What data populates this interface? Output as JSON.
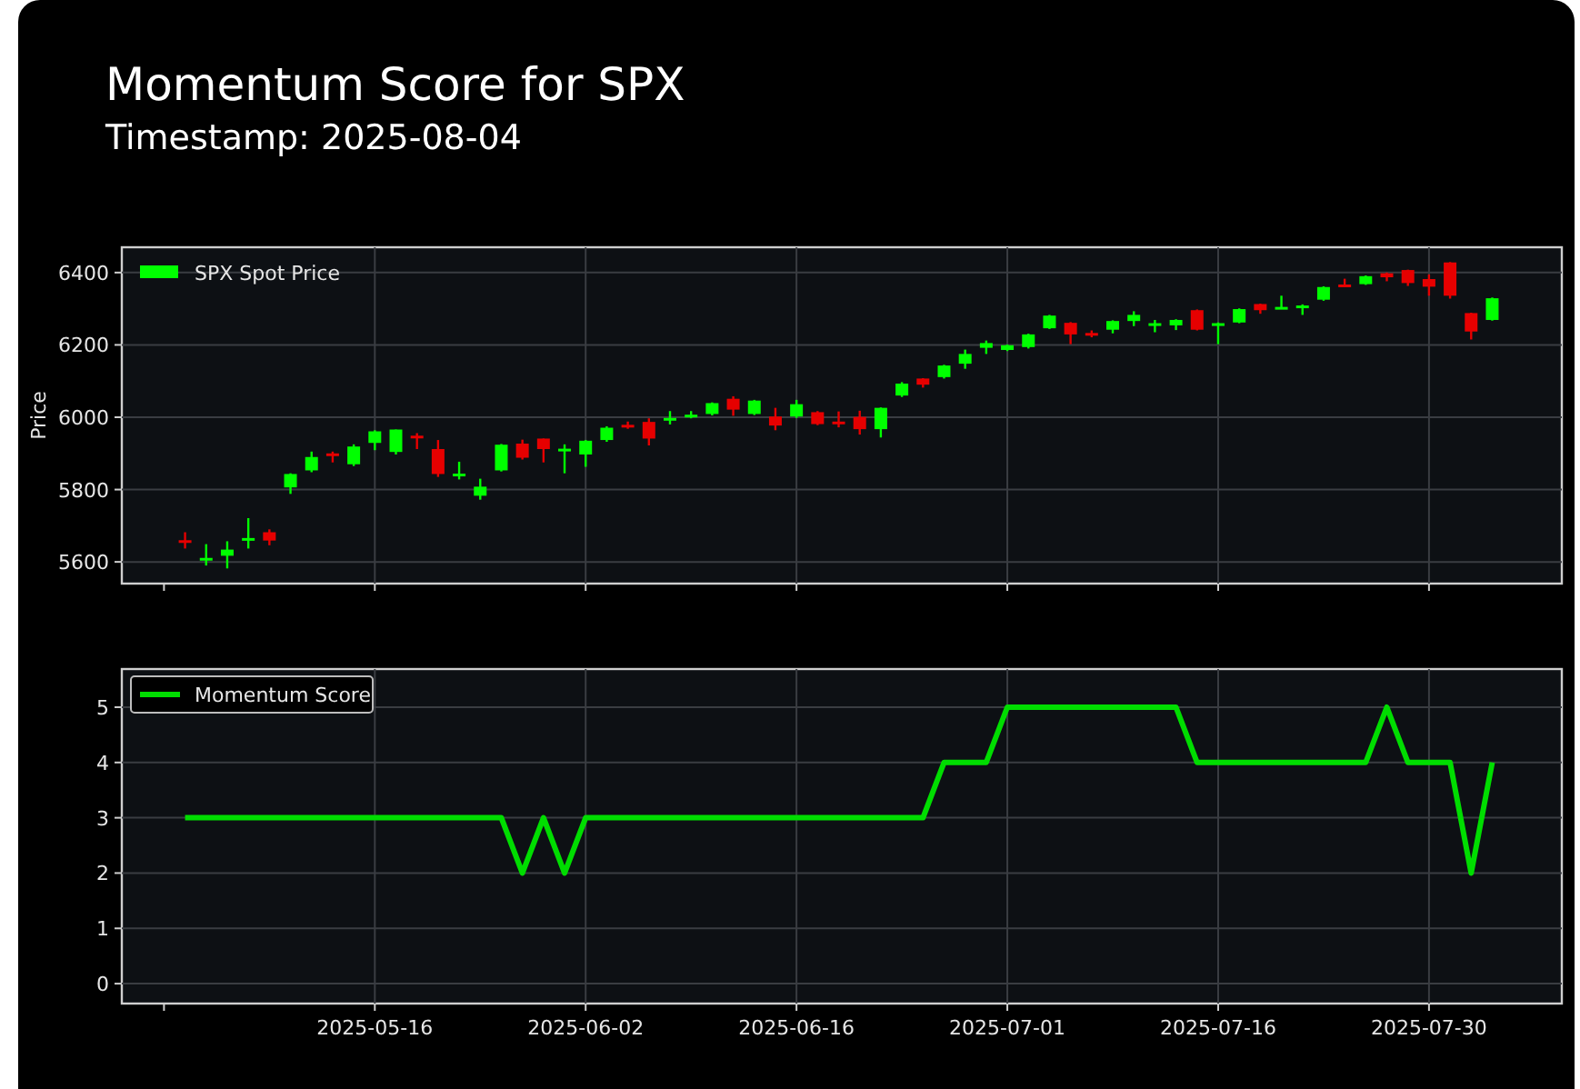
{
  "title": "Momentum Score for SPX",
  "subtitle": "Timestamp: 2025-08-04",
  "price_panel": {
    "chart_data": {
      "type": "candlestick",
      "ylabel": "Price",
      "grid": true,
      "categories": [
        null,
        null,
        null,
        null,
        null,
        null,
        null,
        null,
        null,
        null,
        null,
        null,
        null,
        null,
        null,
        null,
        null,
        null,
        null,
        null,
        null,
        null,
        null,
        null,
        null,
        null,
        null,
        null,
        null,
        null,
        null,
        null,
        null,
        null,
        null,
        null,
        null,
        null,
        null,
        null,
        null,
        null,
        null,
        null,
        null,
        null,
        null,
        null,
        null,
        null,
        null,
        null,
        null,
        null,
        null,
        null,
        null,
        null,
        null,
        null,
        null,
        null,
        null
      ],
      "ylim": [
        5540,
        6470
      ],
      "yticks": [
        5600,
        5800,
        6000,
        6200,
        6400
      ],
      "series": [
        {
          "name": "SPX Spot Price",
          "ohlc": [
            [
              5660,
              5682,
              5637,
              5655
            ],
            [
              5608,
              5649,
              5590,
              5611
            ],
            [
              5617,
              5657,
              5582,
              5634
            ],
            [
              5663,
              5721,
              5637,
              5666
            ],
            [
              5682,
              5690,
              5646,
              5659
            ],
            [
              5806,
              5845,
              5788,
              5843
            ],
            [
              5853,
              5905,
              5848,
              5890
            ],
            [
              5900,
              5905,
              5875,
              5895
            ],
            [
              5870,
              5925,
              5865,
              5919
            ],
            [
              5929,
              5964,
              5909,
              5961
            ],
            [
              5904,
              5966,
              5897,
              5966
            ],
            [
              5949,
              5956,
              5912,
              5944
            ],
            [
              5912,
              5937,
              5835,
              5843
            ],
            [
              5841,
              5877,
              5828,
              5844
            ],
            [
              5783,
              5830,
              5772,
              5808
            ],
            [
              5853,
              5926,
              5850,
              5924
            ],
            [
              5927,
              5938,
              5883,
              5888
            ],
            [
              5941,
              5941,
              5875,
              5912
            ],
            [
              5910,
              5925,
              5845,
              5913
            ],
            [
              5897,
              5937,
              5863,
              5935
            ],
            [
              5937,
              5975,
              5932,
              5971
            ],
            [
              5979,
              5988,
              5968,
              5976
            ],
            [
              5987,
              5997,
              5922,
              5941
            ],
            [
              5995,
              6017,
              5980,
              5998
            ],
            [
              6005,
              6017,
              5997,
              6007
            ],
            [
              6009,
              6041,
              6005,
              6039
            ],
            [
              6051,
              6058,
              6004,
              6021
            ],
            [
              6009,
              6048,
              6006,
              6046
            ],
            [
              6002,
              6026,
              5964,
              5977
            ],
            [
              6002,
              6048,
              5998,
              6036
            ],
            [
              6014,
              6017,
              5978,
              5981
            ],
            [
              5988,
              6016,
              5972,
              5985
            ],
            [
              6001,
              6018,
              5952,
              5967
            ],
            [
              5967,
              6027,
              5944,
              6026
            ],
            [
              6060,
              6097,
              6056,
              6093
            ],
            [
              6107,
              6108,
              6082,
              6090
            ],
            [
              6111,
              6145,
              6107,
              6143
            ],
            [
              6148,
              6187,
              6134,
              6175
            ],
            [
              6192,
              6212,
              6175,
              6205
            ],
            [
              6186,
              6201,
              6183,
              6199
            ],
            [
              6194,
              6231,
              6190,
              6229
            ],
            [
              6246,
              6283,
              6244,
              6281
            ],
            [
              6261,
              6263,
              6202,
              6229
            ],
            [
              6233,
              6240,
              6221,
              6231
            ],
            [
              6242,
              6268,
              6232,
              6266
            ],
            [
              6266,
              6293,
              6252,
              6283
            ],
            [
              6258,
              6269,
              6235,
              6260
            ],
            [
              6254,
              6271,
              6241,
              6269
            ],
            [
              6296,
              6298,
              6240,
              6242
            ],
            [
              6258,
              6262,
              6202,
              6260
            ],
            [
              6262,
              6301,
              6260,
              6299
            ],
            [
              6313,
              6314,
              6286,
              6296
            ],
            [
              6303,
              6336,
              6302,
              6305
            ],
            [
              6307,
              6312,
              6283,
              6309
            ],
            [
              6325,
              6362,
              6322,
              6360
            ],
            [
              6367,
              6383,
              6361,
              6365
            ],
            [
              6368,
              6392,
              6366,
              6390
            ],
            [
              6398,
              6400,
              6376,
              6387
            ],
            [
              6407,
              6408,
              6363,
              6371
            ],
            [
              6382,
              6395,
              6336,
              6361
            ],
            [
              6428,
              6429,
              6328,
              6336
            ],
            [
              6288,
              6289,
              6215,
              6237
            ],
            [
              6269,
              6331,
              6267,
              6329
            ]
          ]
        }
      ]
    }
  },
  "momentum_panel": {
    "chart_data": {
      "type": "line",
      "grid": true,
      "ylim": [
        -0.36,
        5.69
      ],
      "yticks": [
        0,
        1,
        2,
        3,
        4,
        5
      ],
      "categories": [
        null,
        null,
        null,
        null,
        null,
        null,
        null,
        null,
        null,
        "2025-05-16",
        null,
        null,
        null,
        null,
        null,
        null,
        null,
        null,
        null,
        "2025-06-02",
        null,
        null,
        null,
        null,
        null,
        null,
        null,
        null,
        null,
        "2025-06-16",
        null,
        null,
        null,
        null,
        null,
        null,
        null,
        null,
        null,
        "2025-07-01",
        null,
        null,
        null,
        null,
        null,
        null,
        null,
        null,
        null,
        "2025-07-16",
        null,
        null,
        null,
        null,
        null,
        null,
        null,
        null,
        null,
        "2025-07-30",
        null,
        null,
        null
      ],
      "series": [
        {
          "name": "Momentum Score",
          "color": "#00dd00",
          "values": [
            3,
            3,
            3,
            3,
            3,
            3,
            3,
            3,
            3,
            3,
            3,
            3,
            3,
            3,
            3,
            3,
            2,
            3,
            2,
            3,
            3,
            3,
            3,
            3,
            3,
            3,
            3,
            3,
            3,
            3,
            3,
            3,
            3,
            3,
            3,
            3,
            4,
            4,
            4,
            5,
            5,
            5,
            5,
            5,
            5,
            5,
            5,
            5,
            4,
            4,
            4,
            4,
            4,
            4,
            4,
            4,
            4,
            5,
            4,
            4,
            4,
            2,
            4
          ]
        }
      ]
    }
  }
}
